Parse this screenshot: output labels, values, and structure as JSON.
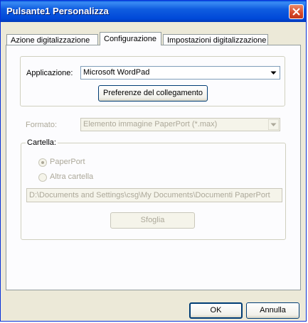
{
  "window": {
    "title": "Pulsante1 Personalizza"
  },
  "tabs": [
    {
      "label": "Azione digitalizzazione"
    },
    {
      "label": "Configurazione"
    },
    {
      "label": "Impostazioni digitalizzazione"
    }
  ],
  "app_group": {
    "label": "Applicazione:",
    "selected": "Microsoft WordPad",
    "link_button": "Preferenze del collegamento"
  },
  "format": {
    "label": "Formato:",
    "selected": "Elemento immagine PaperPort (*.max)"
  },
  "folder": {
    "label": "Cartella:",
    "option_paperport": "PaperPort",
    "option_other": "Altra cartella",
    "path": "D:\\Documents and Settings\\csg\\My Documents\\Documenti PaperPort",
    "browse_button": "Sfoglia"
  },
  "footer": {
    "ok": "OK",
    "cancel": "Annulla"
  },
  "colors": {
    "titlebar": "#0a5ae0",
    "close": "#d6482a",
    "face": "#ece9d8",
    "disabled_text": "#aca899"
  },
  "icons": [
    "close-icon",
    "dropdown-arrow-icon"
  ]
}
